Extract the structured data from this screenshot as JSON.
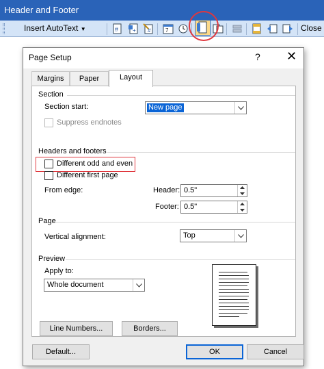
{
  "toolbar": {
    "title": "Header and Footer",
    "insert_autotext": "Insert AutoText",
    "close_label": "Close",
    "icons": [
      "insert-page-number-icon",
      "insert-number-of-pages-icon",
      "format-page-number-icon",
      "insert-date-icon",
      "insert-time-icon",
      "page-setup-icon",
      "show-hide-document-text-icon",
      "same-as-previous-icon",
      "switch-header-footer-icon",
      "show-previous-icon",
      "show-next-icon"
    ]
  },
  "dialog": {
    "title": "Page Setup",
    "help": "?",
    "close": "✕",
    "tabs": [
      "Margins",
      "Paper",
      "Layout"
    ],
    "active_tab": "Layout",
    "section": {
      "heading": "Section",
      "section_start_label": "Section start:",
      "section_start_value": "New page",
      "suppress_endnotes": "Suppress endnotes"
    },
    "headers_footers": {
      "heading": "Headers and footers",
      "different_odd_even": "Different odd and even",
      "different_first_page": "Different first page",
      "from_edge": "From edge:",
      "header_label": "Header:",
      "header_value": "0.5\"",
      "footer_label": "Footer:",
      "footer_value": "0.5\""
    },
    "page": {
      "heading": "Page",
      "vertical_alignment_label": "Vertical alignment:",
      "vertical_alignment_value": "Top"
    },
    "preview": {
      "heading": "Preview",
      "apply_to_label": "Apply to:",
      "apply_to_value": "Whole document"
    },
    "buttons": {
      "line_numbers": "Line Numbers...",
      "borders": "Borders...",
      "default": "Default...",
      "ok": "OK",
      "cancel": "Cancel"
    }
  },
  "colors": {
    "title_bar": "#2a63b8",
    "toolbar_bg": "#d4e4f7",
    "highlight_red": "#e0373d",
    "selection_blue": "#0a64d6"
  }
}
